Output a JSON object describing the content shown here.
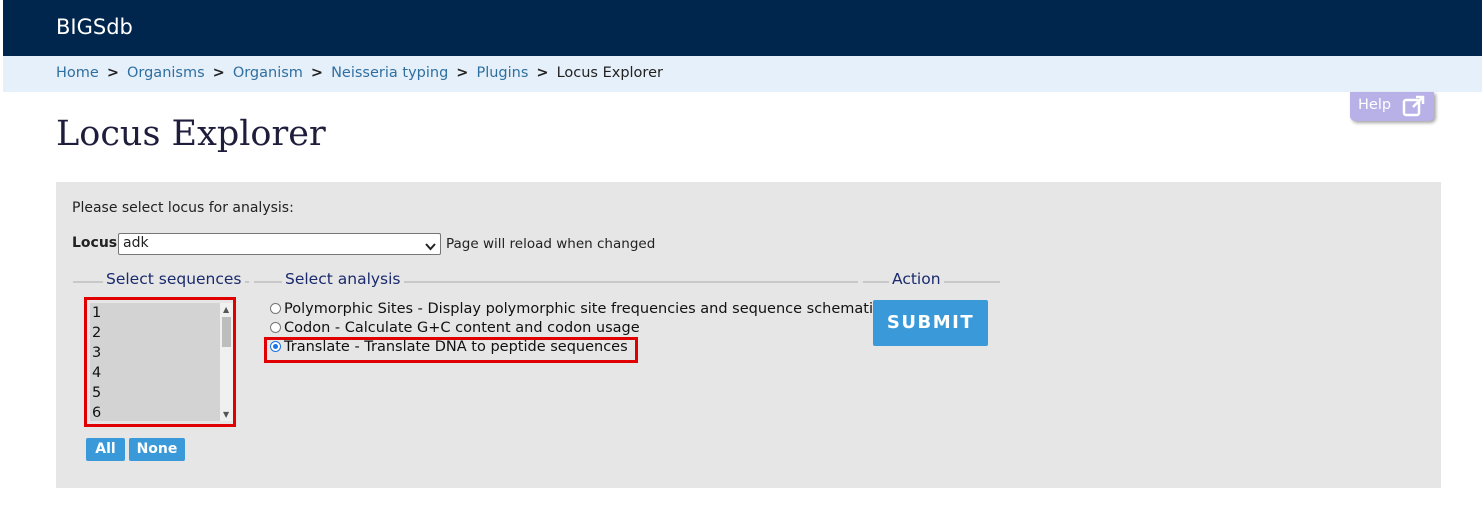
{
  "header": {
    "brand": "BIGSdb"
  },
  "breadcrumb": {
    "items": [
      "Home",
      "Organisms",
      "Organism",
      "Neisseria typing",
      "Plugins"
    ],
    "separator": ">",
    "current": "Locus Explorer"
  },
  "help": {
    "label": "Help",
    "icon": "external-link-icon"
  },
  "page": {
    "title": "Locus Explorer"
  },
  "form": {
    "prompt": "Please select locus for analysis:",
    "locus_label": "Locus:",
    "locus_value": "adk",
    "reload_note": "Page will reload when changed",
    "sequences": {
      "legend": "Select sequences",
      "items": [
        "1",
        "2",
        "3",
        "4",
        "5",
        "6"
      ],
      "all_label": "All",
      "none_label": "None"
    },
    "analysis": {
      "legend": "Select analysis",
      "options": [
        "Polymorphic Sites - Display polymorphic site frequencies and sequence schematic",
        "Codon - Calculate G+C content and codon usage",
        "Translate - Translate DNA to peptide sequences"
      ],
      "selected_index": 2
    },
    "action": {
      "legend": "Action",
      "submit_label": "SUBMIT"
    }
  },
  "colors": {
    "header_bg": "#00264d",
    "accent": "#3a9ad9",
    "highlight": "#e00000"
  }
}
